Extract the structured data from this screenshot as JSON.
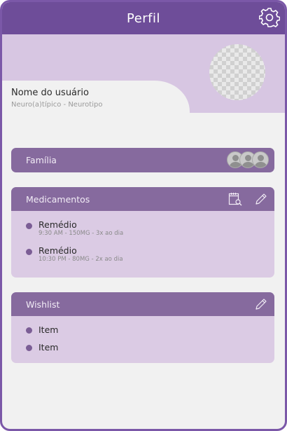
{
  "header": {
    "title": "Perfil",
    "settings_icon": "gear-icon"
  },
  "profile": {
    "name": "Nome do  usuário",
    "subtitle": "Neuro(a)típico - Neurotipo",
    "avatar_icon": "avatar-placeholder"
  },
  "family": {
    "title": "Família",
    "member_count": 3,
    "member_icon": "person-avatar-icon"
  },
  "medications": {
    "title": "Medicamentos",
    "icons": [
      "calendar-search-icon",
      "pencil-icon"
    ],
    "items": [
      {
        "name": "Remédio",
        "detail": "9:30 AM - 150MG - 3x ao dia"
      },
      {
        "name": "Remédio",
        "detail": "10:30 PM - 80MG - 2x ao dia"
      }
    ]
  },
  "wishlist": {
    "title": "Wishlist",
    "icons": [
      "pencil-icon"
    ],
    "items": [
      {
        "label": "Item"
      },
      {
        "label": "Item"
      }
    ]
  },
  "colors": {
    "accent": "#6e4d99",
    "frame_border": "#7b58a8",
    "card_header": "#866a9e",
    "card_body": "#dbcbe4",
    "banner": "#d7c6e2",
    "background": "#f1f1f1"
  }
}
